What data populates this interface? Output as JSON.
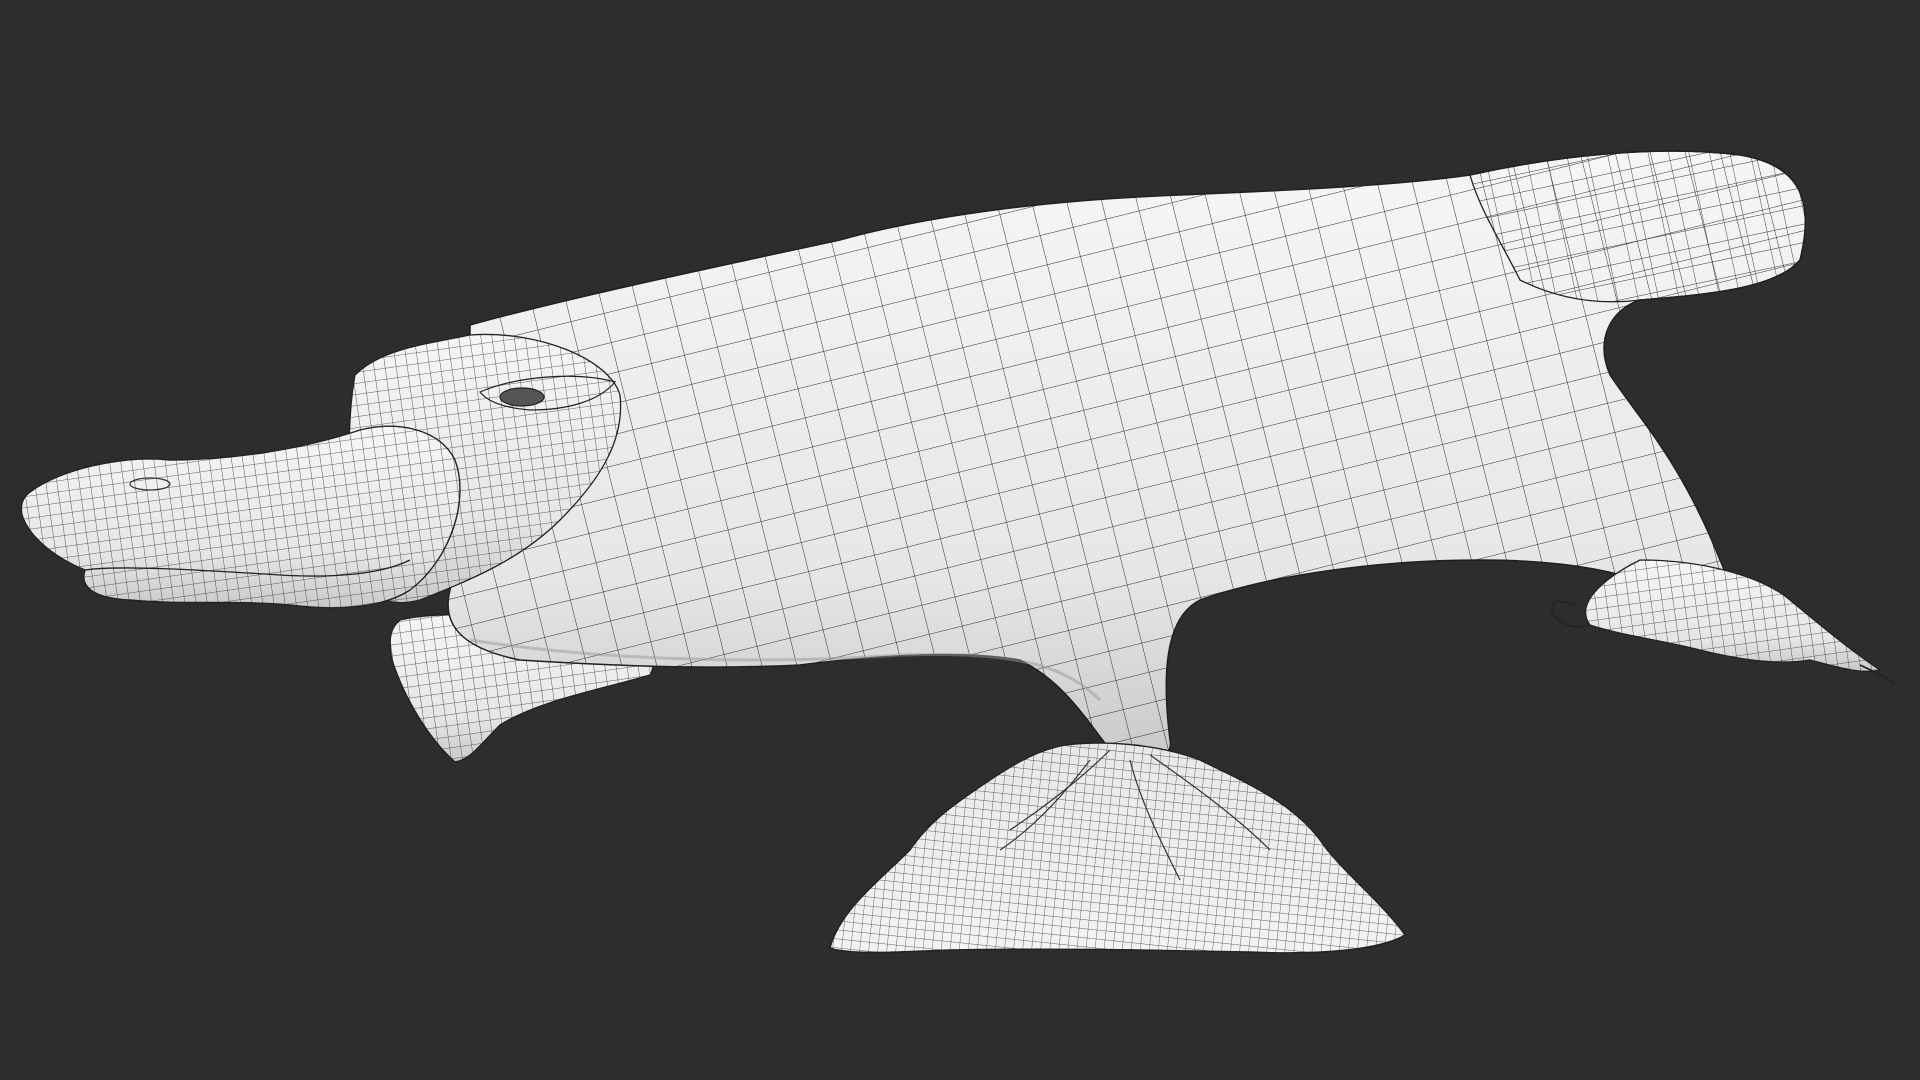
{
  "scene": {
    "subject": "platypus-wireframe-model",
    "colors": {
      "background": "#2d2d2d",
      "surface": "#f1f1f1",
      "surface_shade": "#cfcfcf",
      "wire": "#2a2a2a"
    }
  }
}
